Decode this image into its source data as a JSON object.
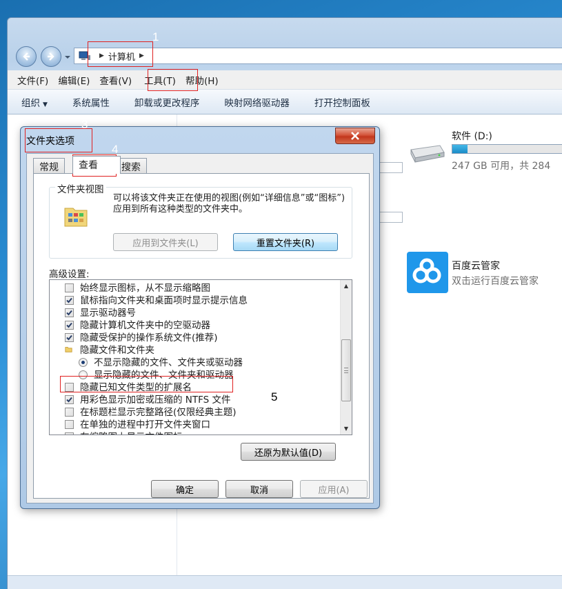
{
  "address": {
    "crumb": "计算机"
  },
  "menu": [
    "文件(F)",
    "编辑(E)",
    "查看(V)",
    "工具(T)",
    "帮助(H)"
  ],
  "commands": [
    "组织",
    "系统属性",
    "卸载或更改程序",
    "映射网络驱动器",
    "打开控制面板"
  ],
  "drive": {
    "name": "软件 (D:)",
    "free": "247 GB 可用，共 284",
    "used_fraction": 0.13
  },
  "baidu": {
    "name": "百度云管家",
    "desc": "双击运行百度云管家"
  },
  "dialog": {
    "title": "文件夹选项",
    "tabs": [
      "常规",
      "查看",
      "搜索"
    ],
    "group_title": "文件夹视图",
    "group_desc": "可以将该文件夹正在使用的视图(例如“详细信息”或“图标”)应用到所有这种类型的文件夹中。",
    "apply_to_folders": "应用到文件夹(L)",
    "reset_folders": "重置文件夹(R)",
    "advanced_label": "高级设置:",
    "advanced_items": [
      {
        "type": "checkbox",
        "checked": false,
        "label": "始终显示图标，从不显示缩略图"
      },
      {
        "type": "checkbox",
        "checked": true,
        "label": "鼠标指向文件夹和桌面项时显示提示信息"
      },
      {
        "type": "checkbox",
        "checked": true,
        "label": "显示驱动器号"
      },
      {
        "type": "checkbox",
        "checked": true,
        "label": "隐藏计算机文件夹中的空驱动器"
      },
      {
        "type": "checkbox",
        "checked": true,
        "label": "隐藏受保护的操作系统文件(推荐)"
      },
      {
        "type": "folder",
        "label": "隐藏文件和文件夹"
      },
      {
        "type": "radio",
        "checked": true,
        "label": "不显示隐藏的文件、文件夹或驱动器"
      },
      {
        "type": "radio",
        "checked": false,
        "label": "显示隐藏的文件、文件夹和驱动器"
      },
      {
        "type": "checkbox",
        "checked": false,
        "label": "隐藏已知文件类型的扩展名"
      },
      {
        "type": "checkbox",
        "checked": true,
        "label": "用彩色显示加密或压缩的 NTFS 文件"
      },
      {
        "type": "checkbox",
        "checked": false,
        "label": "在标题栏显示完整路径(仅限经典主题)"
      },
      {
        "type": "checkbox",
        "checked": false,
        "label": "在单独的进程中打开文件夹窗口"
      },
      {
        "type": "checkbox",
        "checked": false,
        "label": "在缩略图上显示文件图标"
      }
    ],
    "restore_defaults": "还原为默认值(D)",
    "ok": "确定",
    "cancel": "取消",
    "apply": "应用(A)"
  },
  "annotations": [
    "1",
    "3",
    "4",
    "5"
  ],
  "colors": {
    "annotation": "#e02020",
    "accent": "#1f97ea",
    "close": "#c2361c"
  }
}
